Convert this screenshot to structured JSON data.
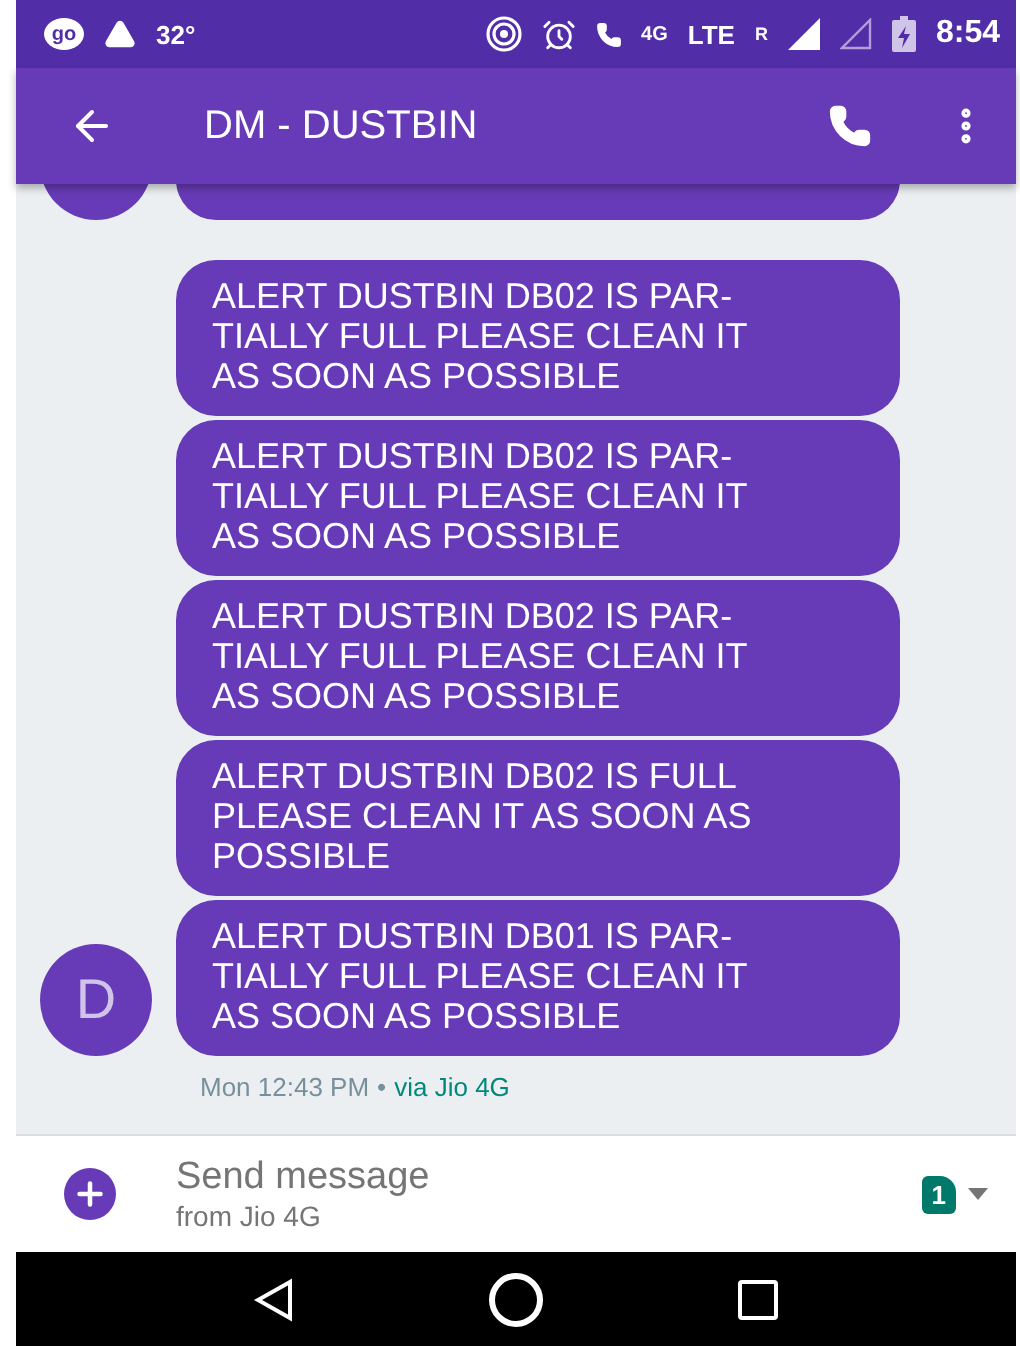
{
  "status_bar": {
    "app_badge": "go",
    "temperature": "32°",
    "network": "4G",
    "lte": "LTE",
    "roaming": "R",
    "time": "8:54"
  },
  "app_bar": {
    "title": "DM - DUSTBIN"
  },
  "messages": [
    {
      "text": "ALERT DUSTBIN DB02 IS PAR-TIALLY FULL PLEASE CLEAN IT AS SOON AS POSSIBLE"
    },
    {
      "text": "ALERT DUSTBIN DB02 IS PAR-TIALLY FULL PLEASE CLEAN IT AS SOON AS POSSIBLE"
    },
    {
      "text": "ALERT DUSTBIN DB02 IS PAR-TIALLY FULL PLEASE CLEAN IT AS SOON AS POSSIBLE"
    },
    {
      "text": "ALERT DUSTBIN DB02 IS FULL PLEASE CLEAN IT AS SOON AS POSSIBLE"
    },
    {
      "text": "ALERT DUSTBIN DB01 IS PAR-TIALLY FULL PLEASE CLEAN IT AS SOON AS POSSIBLE",
      "avatar": "D"
    }
  ],
  "timestamp": {
    "time": "Mon 12:43 PM",
    "separator": "•",
    "via": "via Jio 4G"
  },
  "compose": {
    "placeholder": "Send message",
    "subtitle": "from Jio 4G",
    "sim": "1"
  }
}
